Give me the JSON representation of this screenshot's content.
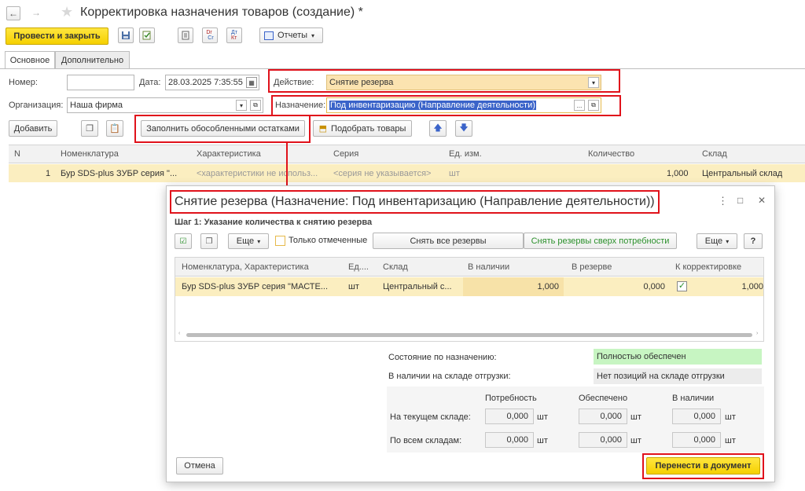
{
  "window": {
    "title": "Корректировка назначения товаров (создание) *"
  },
  "toolbar": {
    "post_close": "Провести и закрыть",
    "dt_label": "Dт",
    "kt_label": "Кт",
    "dt2_label": "Дт",
    "kt2_label": "Кт",
    "reports": "Отчеты"
  },
  "tabs": [
    "Основное",
    "Дополнительно"
  ],
  "form": {
    "number_label": "Номер:",
    "number_value": "",
    "date_label": "Дата:",
    "date_value": "28.03.2025  7:35:55",
    "action_label": "Действие:",
    "action_value": "Снятие резерва",
    "org_label": "Организация:",
    "org_value": "Наша фирма",
    "purpose_label": "Назначение:",
    "purpose_value": "Под инвентаризацию (Направление деятельности)",
    "ellipsis": "..."
  },
  "actions": {
    "add": "Добавить",
    "fill": "Заполнить обособленными остатками",
    "pick": "Подобрать товары"
  },
  "table": {
    "headers": [
      "N",
      "Номенклатура",
      "Характеристика",
      "Серия",
      "Ед. изм.",
      "Количество",
      "Склад"
    ],
    "row": {
      "n": "1",
      "item": "Бур SDS-plus ЗУБР серия \"...",
      "characteristic": "<характеристики не использ...",
      "series": "<серия не указывается>",
      "unit": "шт",
      "qty": "1,000",
      "warehouse": "Центральный склад"
    }
  },
  "dialog": {
    "title": "Снятие резерва (Назначение: Под инвентаризацию (Направление деятельности))",
    "step": "Шаг 1: Указание количества к снятию резерва",
    "more": "Еще",
    "only_marked": "Только отмеченные",
    "remove_all": "Снять все резервы",
    "remove_over": "Снять резервы сверх потребности",
    "help": "?",
    "headers": [
      "Номенклатура, Характеристика",
      "Ед....",
      "Склад",
      "В наличии",
      "В резерве",
      "К корректировке"
    ],
    "row": {
      "item": "Бур SDS-plus ЗУБР серия \"МАСТЕ...",
      "unit": "шт",
      "warehouse": "Центральный с...",
      "available": "1,000",
      "reserved": "0,000",
      "correction": "1,000"
    },
    "status_label": "Состояние по назначению:",
    "status_value": "Полностью обеспечен",
    "stock_label": "В наличии на складе отгрузки:",
    "stock_value": "Нет позиций на складе отгрузки",
    "col_need": "Потребность",
    "col_provided": "Обеспечено",
    "col_available": "В наличии",
    "row_current": "На текущем складе:",
    "row_all": "По всем складам:",
    "zero": "0,000",
    "unit": "шт",
    "cancel": "Отмена",
    "transfer": "Перенести в документ",
    "menu_dots": "⋮",
    "maximize": "□",
    "close": "✕"
  },
  "colors": {
    "accent_yellow": "#f5d000",
    "selected_row": "#fbeec0",
    "highlight_red": "#e0121b",
    "status_green": "#c7f5c2",
    "link_green": "#2a8f2a",
    "selection_blue": "#3a63c9"
  }
}
